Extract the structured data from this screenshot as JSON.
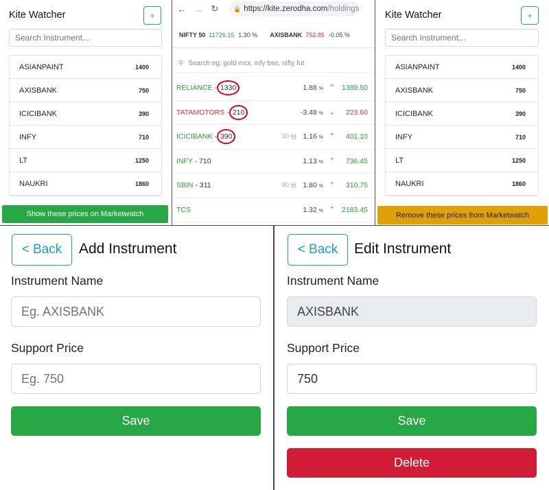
{
  "watcher_left": {
    "title": "Kite Watcher",
    "add_icon": "+",
    "search_placeholder": "Search Instrument...",
    "items": [
      {
        "name": "ASIANPAINT",
        "price": "1400"
      },
      {
        "name": "AXISBANK",
        "price": "750"
      },
      {
        "name": "ICICIBANK",
        "price": "390"
      },
      {
        "name": "INFY",
        "price": "710"
      },
      {
        "name": "LT",
        "price": "1250"
      },
      {
        "name": "NAUKRI",
        "price": "1860"
      }
    ],
    "action_label": "Show these prices on Marketwatch",
    "action_color": "#28a745"
  },
  "kite": {
    "url_host": "https://kite.zerodha.com",
    "url_path": "/holdings",
    "indices": [
      {
        "symbol": "NIFTY 50",
        "value": "11726.15",
        "change": "1.30 %",
        "direction": "up"
      },
      {
        "symbol": "AXISBANK",
        "value": "752.85",
        "change": "-0.05 %",
        "direction": "down"
      }
    ],
    "search_placeholder": "Search eg: gold mcx, infy bse, nifty fut",
    "rows": [
      {
        "symbol": "RELIANCE",
        "sep": " -",
        "qty": "1330",
        "circled": true,
        "holdings": "",
        "pct": "1.88",
        "pct_unit": "%",
        "arrow": "^",
        "ltp": "1389.50",
        "direction": "up"
      },
      {
        "symbol": "TATAMOTORS",
        "sep": " -",
        "qty": "210",
        "circled": true,
        "holdings": "",
        "pct": "-3.48",
        "pct_unit": "%",
        "arrow": "v",
        "ltp": "223.60",
        "direction": "down"
      },
      {
        "symbol": "ICICIBANK",
        "sep": " -",
        "qty": "390",
        "circled": true,
        "holdings": "30",
        "pct": "1.16",
        "pct_unit": "%",
        "arrow": "^",
        "ltp": "401.10",
        "direction": "up"
      },
      {
        "symbol": "INFY",
        "sep": " -",
        "qty": " 710",
        "circled": false,
        "holdings": "",
        "pct": "1.13",
        "pct_unit": "%",
        "arrow": "^",
        "ltp": "736.45",
        "direction": "up"
      },
      {
        "symbol": "SBIN",
        "sep": " -",
        "qty": " 311",
        "circled": false,
        "holdings": "80",
        "pct": "1.80",
        "pct_unit": "%",
        "arrow": "^",
        "ltp": "310.75",
        "direction": "up"
      },
      {
        "symbol": "TCS",
        "sep": "",
        "qty": "",
        "circled": false,
        "holdings": "",
        "pct": "1.32",
        "pct_unit": "%",
        "arrow": "^",
        "ltp": "2183.45",
        "direction": "up"
      }
    ]
  },
  "watcher_right": {
    "title": "Kite Watcher",
    "add_icon": "+",
    "search_placeholder": "Search Instrument...",
    "items": [
      {
        "name": "ASIANPAINT",
        "price": "1400"
      },
      {
        "name": "AXISBANK",
        "price": "750"
      },
      {
        "name": "ICICIBANK",
        "price": "390"
      },
      {
        "name": "INFY",
        "price": "710"
      },
      {
        "name": "LT",
        "price": "1250"
      },
      {
        "name": "NAUKRI",
        "price": "1860"
      }
    ],
    "action_label": "Remove these prices from Marketwatch",
    "action_color": "#e0a106"
  },
  "add_form": {
    "back_label": "< Back",
    "title": "Add Instrument",
    "name_label": "Instrument Name",
    "name_placeholder": "Eg. AXISBANK",
    "price_label": "Support Price",
    "price_placeholder": "Eg. 750",
    "save_label": "Save"
  },
  "edit_form": {
    "back_label": "< Back",
    "title": "Edit Instrument",
    "name_label": "Instrument Name",
    "name_value": "AXISBANK",
    "price_label": "Support Price",
    "price_value": "750",
    "save_label": "Save",
    "delete_label": "Delete"
  }
}
